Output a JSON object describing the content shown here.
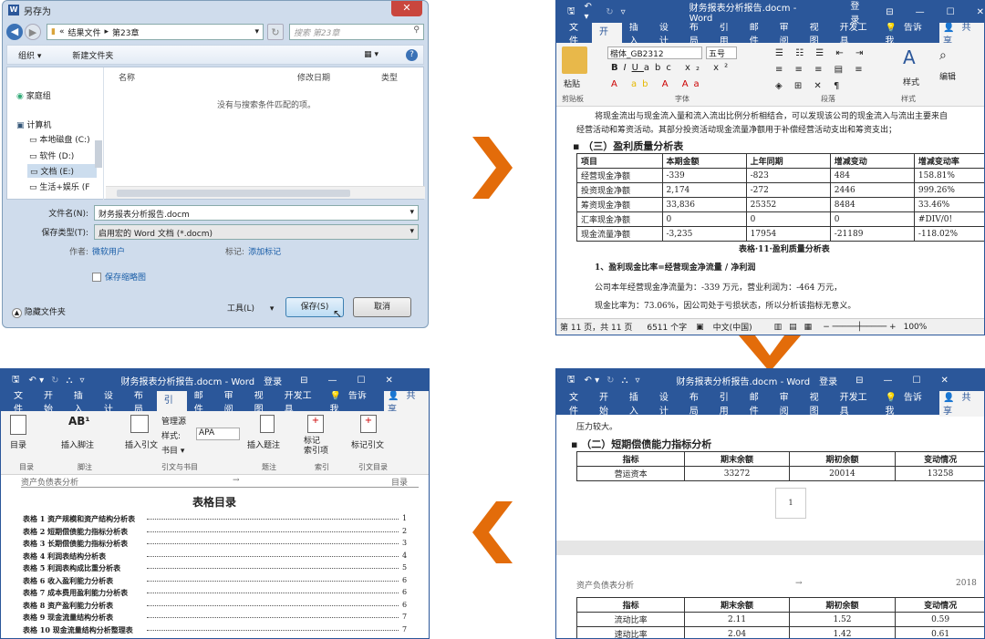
{
  "save_dialog": {
    "title": "另存为",
    "path_prefix": "«",
    "path_items": [
      "结果文件",
      "第23章"
    ],
    "search_placeholder": "搜索 第23章",
    "organize": "组织 ▾",
    "new_folder": "新建文件夹",
    "nav_items": [
      "家庭组",
      "计算机",
      "本地磁盘 (C:)",
      "软件 (D:)",
      "文档 (E:)",
      "生活+娱乐 (F"
    ],
    "col_name": "名称",
    "col_date": "修改日期",
    "col_type": "类型",
    "empty_msg": "没有与搜索条件匹配的项。",
    "filename_label": "文件名(N):",
    "filename_value": "财务报表分析报告.docm",
    "filetype_label": "保存类型(T):",
    "filetype_value": "启用宏的 Word 文档 (*.docm)",
    "author_label": "作者:",
    "author_value": "微软用户",
    "tags_label": "标记:",
    "tags_value": "添加标记",
    "thumbnail": "保存缩略图",
    "hide_folders": "隐藏文件夹",
    "tools": "工具(L)",
    "save": "保存(S)",
    "cancel": "取消"
  },
  "word1": {
    "title": "财务报表分析报告.docm - Word",
    "login": "登录",
    "tabs": [
      "文件",
      "开始",
      "插入",
      "设计",
      "布局",
      "引用",
      "邮件",
      "审阅",
      "视图",
      "开发工具"
    ],
    "tell": "告诉我",
    "share": "共享",
    "font_name": "楷体_GB2312",
    "font_size": "五号",
    "paste": "粘贴",
    "styles": "样式",
    "edit": "编辑",
    "group_clipboard": "剪贴板",
    "group_font": "字体",
    "group_para": "段落",
    "group_styles": "样式",
    "para1": "将现金流出与现金流入量和流入流出比例分析相结合，可以发现该公司的现金流入与流出主要来自",
    "para1b": "经营活动和筹资活动。其部分投资活动现金流量净额用于补偿经营活动支出和筹资支出；",
    "heading": "（三）盈利质量分析表",
    "table_header": [
      "项目",
      "本期金额",
      "上年同期",
      "增减变动",
      "增减变动率"
    ],
    "table_rows": [
      [
        "经营现金净额",
        "-339",
        "-823",
        "484",
        "158.81%"
      ],
      [
        "投资现金净额",
        "2,174",
        "-272",
        "2446",
        "999.26%"
      ],
      [
        "筹资现金净额",
        "33,836",
        "25352",
        "8484",
        "33.46%"
      ],
      [
        "汇率现金净额",
        "0",
        "0",
        "0",
        "#DIV/0!"
      ],
      [
        "现金流量净额",
        "-3,235",
        "17954",
        "-21189",
        "-118.02%"
      ]
    ],
    "caption": "表格·11·盈利质量分析表",
    "sub1": "1、盈利现金比率=经营现金净流量 / 净利润",
    "line1": "公司本年经营现金净流量为：-339 万元，营业利润为：-464 万元，",
    "line2": "现金比率为：73.06%，因公司处于亏损状态，所以分析该指标无意义。",
    "status_page": "第 11 页，共 11 页",
    "status_words": "6511 个字",
    "status_lang": "中文(中国)",
    "zoom": "100%"
  },
  "word2": {
    "title": "财务报表分析报告.docm - Word",
    "login": "登录",
    "tabs": [
      "文件",
      "开始",
      "插入",
      "设计",
      "布局",
      "引用",
      "邮件",
      "审阅",
      "视图",
      "开发工具"
    ],
    "tell": "告诉我",
    "share": "共享",
    "line0": "压力较大。",
    "heading": "（二）短期偿债能力指标分析",
    "t1_header": [
      "指标",
      "期末余额",
      "期初余额",
      "变动情况"
    ],
    "t1_row": [
      "营运资本",
      "33272",
      "20014",
      "13258"
    ],
    "mark": "1",
    "header_left": "资产负债表分析",
    "header_arrow": "→",
    "header_right": "2018",
    "t2_header": [
      "指标",
      "期末余额",
      "期初余额",
      "变动情况"
    ],
    "t2_rows": [
      [
        "流动比率",
        "2.11",
        "1.52",
        "0.59"
      ],
      [
        "速动比率",
        "2.04",
        "1.42",
        "0.61"
      ]
    ]
  },
  "word3": {
    "title": "财务报表分析报告.docm - Word",
    "login": "登录",
    "tabs": [
      "文件",
      "开始",
      "插入",
      "设计",
      "布局",
      "引用",
      "邮件",
      "审阅",
      "视图",
      "开发工具"
    ],
    "tell": "告诉我",
    "share": "共享",
    "rb_toc": "目录",
    "rb_footnote": "插入脚注",
    "rb_citation": "插入引文",
    "rb_manage": "管理源",
    "rb_style": "样式:",
    "rb_style_val": "APA",
    "rb_biblio": "书目 ▾",
    "rb_caption": "插入题注",
    "rb_mark": "标记\n索引项",
    "rb_markcite": "标记引文",
    "groups": [
      "目录",
      "脚注",
      "引文与书目",
      "题注",
      "索引",
      "引文目录"
    ],
    "header_left": "资产负债表分析",
    "header_arrow": "→",
    "header_right": "目录",
    "toc_title": "表格目录",
    "toc": [
      [
        "表格 1 资产规模和资产结构分析表",
        "1"
      ],
      [
        "表格 2 短期偿债能力指标分析表",
        "2"
      ],
      [
        "表格 3 长期偿债能力指标分析表",
        "3"
      ],
      [
        "表格 4 利润表结构分析表",
        "4"
      ],
      [
        "表格 5 利润表构成比重分析表",
        "5"
      ],
      [
        "表格 6 收入盈利能力分析表",
        "6"
      ],
      [
        "表格 7 成本费用盈利能力分析表",
        "6"
      ],
      [
        "表格 8 资产盈利能力分析表",
        "6"
      ],
      [
        "表格 9 现金流量结构分析表",
        "7"
      ],
      [
        "表格 10 现金流量结构分析整理表",
        "7"
      ]
    ]
  }
}
